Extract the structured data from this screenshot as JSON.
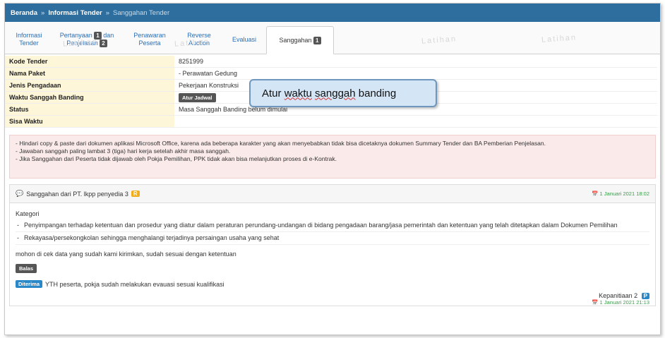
{
  "breadcrumb": {
    "home": "Beranda",
    "separator": "»",
    "section": "Informasi Tender",
    "current": "Sanggahan Tender"
  },
  "tabs": [
    {
      "label": "Informasi Tender",
      "badge": ""
    },
    {
      "label": "Pertanyaan dan Penjelasan",
      "label_a": "Pertanyaan",
      "label_b": "dan",
      "label_c": "Penjelasan",
      "badge": "1",
      "badge2": "2"
    },
    {
      "label": "Penawaran Peserta",
      "badge": ""
    },
    {
      "label": "Reverse Auction",
      "badge": ""
    },
    {
      "label": "Evaluasi",
      "badge": ""
    },
    {
      "label": "Sanggahan",
      "badge": "1"
    }
  ],
  "watermark": "Latihan",
  "info": {
    "rows": [
      {
        "label": "Kode Tender",
        "value": "8251999"
      },
      {
        "label": "Nama Paket",
        "value": "- Perawatan Gedung"
      },
      {
        "label": "Jenis Pengadaan",
        "value": "Pekerjaan Konstruksi"
      },
      {
        "label": "Waktu Sanggah Banding",
        "value": ""
      },
      {
        "label": "Status",
        "value": "Masa Sanggah Banding belum dimulai"
      },
      {
        "label": "Sisa Waktu",
        "value": ""
      }
    ],
    "atur_jadwal_button": "Atur Jadwal"
  },
  "callout": {
    "prefix": "Atur ",
    "word1": "waktu",
    "space": " ",
    "word2": "sanggah",
    "suffix": " banding"
  },
  "warnings": [
    "- Hindari copy & paste dari dokumen aplikasi Microsoft Office, karena ada beberapa karakter yang akan menyebabkan tidak bisa dicetaknya dokumen Summary Tender dan BA Pemberian Penjelasan.",
    "- Jawaban sanggah paling lambat 3 (tiga) hari kerja setelah akhir masa sanggah.",
    "- Jika Sanggahan dari Peserta tidak dijawab oleh Pokja Pemilihan, PPK tidak akan bisa melanjutkan proses di e-Kontrak."
  ],
  "sanggahan": {
    "title": "Sanggahan dari PT. lkpp penyedia 3",
    "badge": "R",
    "date": "1 Januari 2021 18:02",
    "kategori_label": "Kategori",
    "kategori": [
      "Penyimpangan terhadap ketentuan dan prosedur yang diatur dalam peraturan perundang-undangan di bidang pengadaan barang/jasa pemerintah dan ketentuan yang telah ditetapkan dalam Dokumen Pemilihan",
      "Rekayasa/persekongkolan sehingga menghalangi terjadinya persaingan usaha yang sehat"
    ],
    "message": "mohon di cek data yang sudah kami kirimkan, sudah sesuai dengan ketentuan",
    "reply_button": "Balas",
    "reply": {
      "status": "Diterima",
      "text": "YTH  peserta, pokja sudah melakukan evauasi sesuai kualifikasi",
      "author": "Kepanitiaan 2",
      "author_badge": "P",
      "date": "1 Januari 2021 21:13"
    }
  },
  "colors": {
    "header_bg": "#2e6e9e",
    "label_bg": "#fdf6d8",
    "warning_bg": "#fbeaea",
    "callout_bg": "#d4e5f5",
    "accent_blue": "#2a88c8",
    "badge_orange": "#f0ad1e",
    "date_green": "#3a9d4a"
  }
}
